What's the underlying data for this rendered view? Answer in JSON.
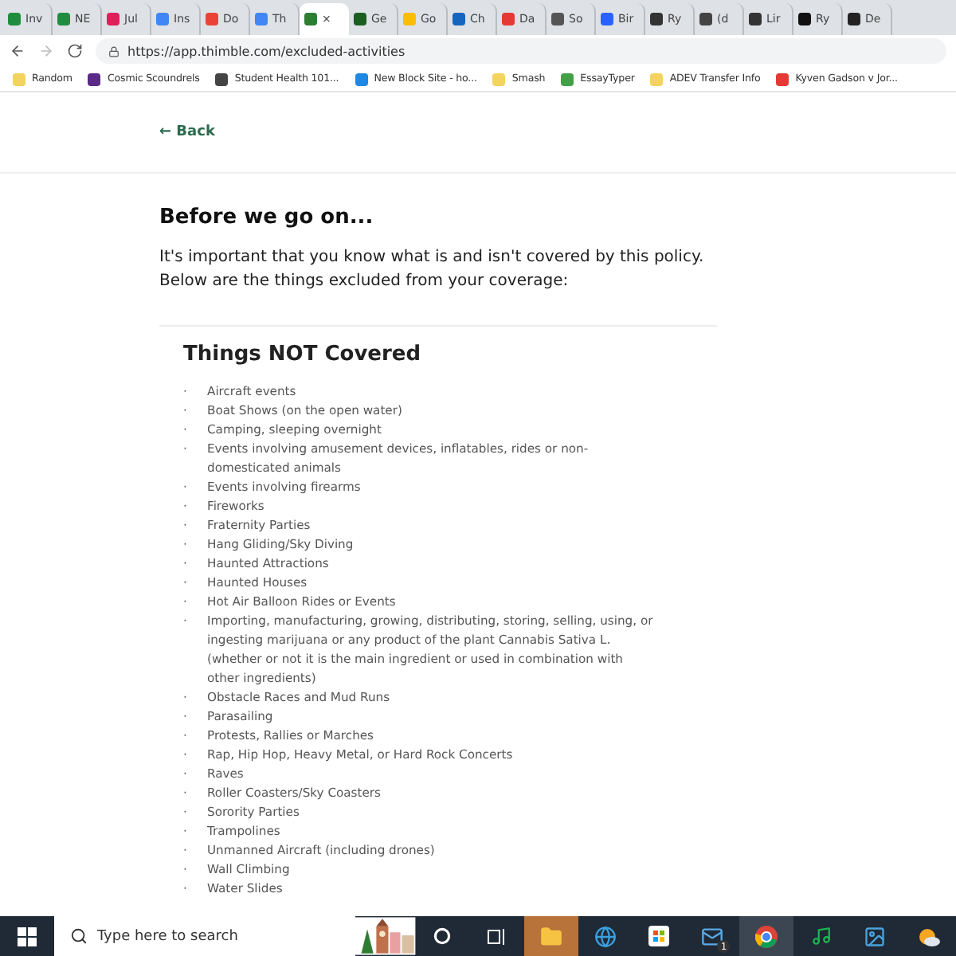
{
  "tabs": [
    {
      "label": "Inv",
      "selected": false,
      "color": "#1e8e3e"
    },
    {
      "label": "NE",
      "selected": false,
      "color": "#1e8e3e"
    },
    {
      "label": "Jul",
      "selected": false,
      "color": "#e01e5a"
    },
    {
      "label": "Ins",
      "selected": false,
      "color": "#4285f4"
    },
    {
      "label": "Do",
      "selected": false,
      "color": "#ea4335"
    },
    {
      "label": "Th",
      "selected": false,
      "color": "#4285f4"
    },
    {
      "label": "×",
      "selected": true,
      "color": "#2e7d32"
    },
    {
      "label": "Ge",
      "selected": false,
      "color": "#1b5e20"
    },
    {
      "label": "Go",
      "selected": false,
      "color": "#fbbc04"
    },
    {
      "label": "Ch",
      "selected": false,
      "color": "#1565c0"
    },
    {
      "label": "Da",
      "selected": false,
      "color": "#e53935"
    },
    {
      "label": "So",
      "selected": false,
      "color": "#555555"
    },
    {
      "label": "Bir",
      "selected": false,
      "color": "#2962ff"
    },
    {
      "label": "Ry",
      "selected": false,
      "color": "#333333"
    },
    {
      "label": "(d",
      "selected": false,
      "color": "#444444"
    },
    {
      "label": "Lir",
      "selected": false,
      "color": "#333333"
    },
    {
      "label": "Ry",
      "selected": false,
      "color": "#111111"
    },
    {
      "label": "De",
      "selected": false,
      "color": "#222222"
    }
  ],
  "address": "https://app.thimble.com/excluded-activities",
  "bookmarks": [
    {
      "label": "Random",
      "color": "#f4d35e"
    },
    {
      "label": "Cosmic Scoundrels",
      "color": "#5b2a86"
    },
    {
      "label": "Student Health 101...",
      "color": "#444444"
    },
    {
      "label": "New Block Site - ho...",
      "color": "#1e88e5"
    },
    {
      "label": "Smash",
      "color": "#f4d35e"
    },
    {
      "label": "EssayTyper",
      "color": "#43a047"
    },
    {
      "label": "ADEV Transfer Info",
      "color": "#f4d35e"
    },
    {
      "label": "Kyven Gadson v Jor...",
      "color": "#e53935"
    }
  ],
  "back": "← Back",
  "heading": "Before we go on...",
  "intro": "It's important that you know what is and isn't covered by this policy. Below are the things excluded from your coverage:",
  "list_title": "Things NOT Covered",
  "bullet": "·",
  "items": [
    "Aircraft events",
    "Boat Shows (on the open water)",
    "Camping, sleeping overnight",
    "Events involving amusement devices, inflatables, rides or non-domesticated animals",
    "Events involving firearms",
    "Fireworks",
    "Fraternity Parties",
    "Hang Gliding/Sky Diving",
    "Haunted Attractions",
    "Haunted Houses",
    "Hot Air Balloon Rides or Events",
    "Importing, manufacturing, growing, distributing, storing, selling, using, or ingesting marijuana or any product of the plant Cannabis Sativa L. (whether or not it is the main ingredient or used in combination with other ingredients)",
    "Obstacle Races and Mud Runs",
    "Parasailing",
    "Protests, Rallies or Marches",
    "Rap, Hip Hop, Heavy Metal, or Hard Rock Concerts",
    "Raves",
    "Roller Coasters/Sky Coasters",
    "Sorority Parties",
    "Trampolines",
    "Unmanned Aircraft (including drones)",
    "Wall Climbing",
    "Water Slides"
  ],
  "taskbar": {
    "search_placeholder": "Type here to search",
    "mail_badge": "1"
  }
}
